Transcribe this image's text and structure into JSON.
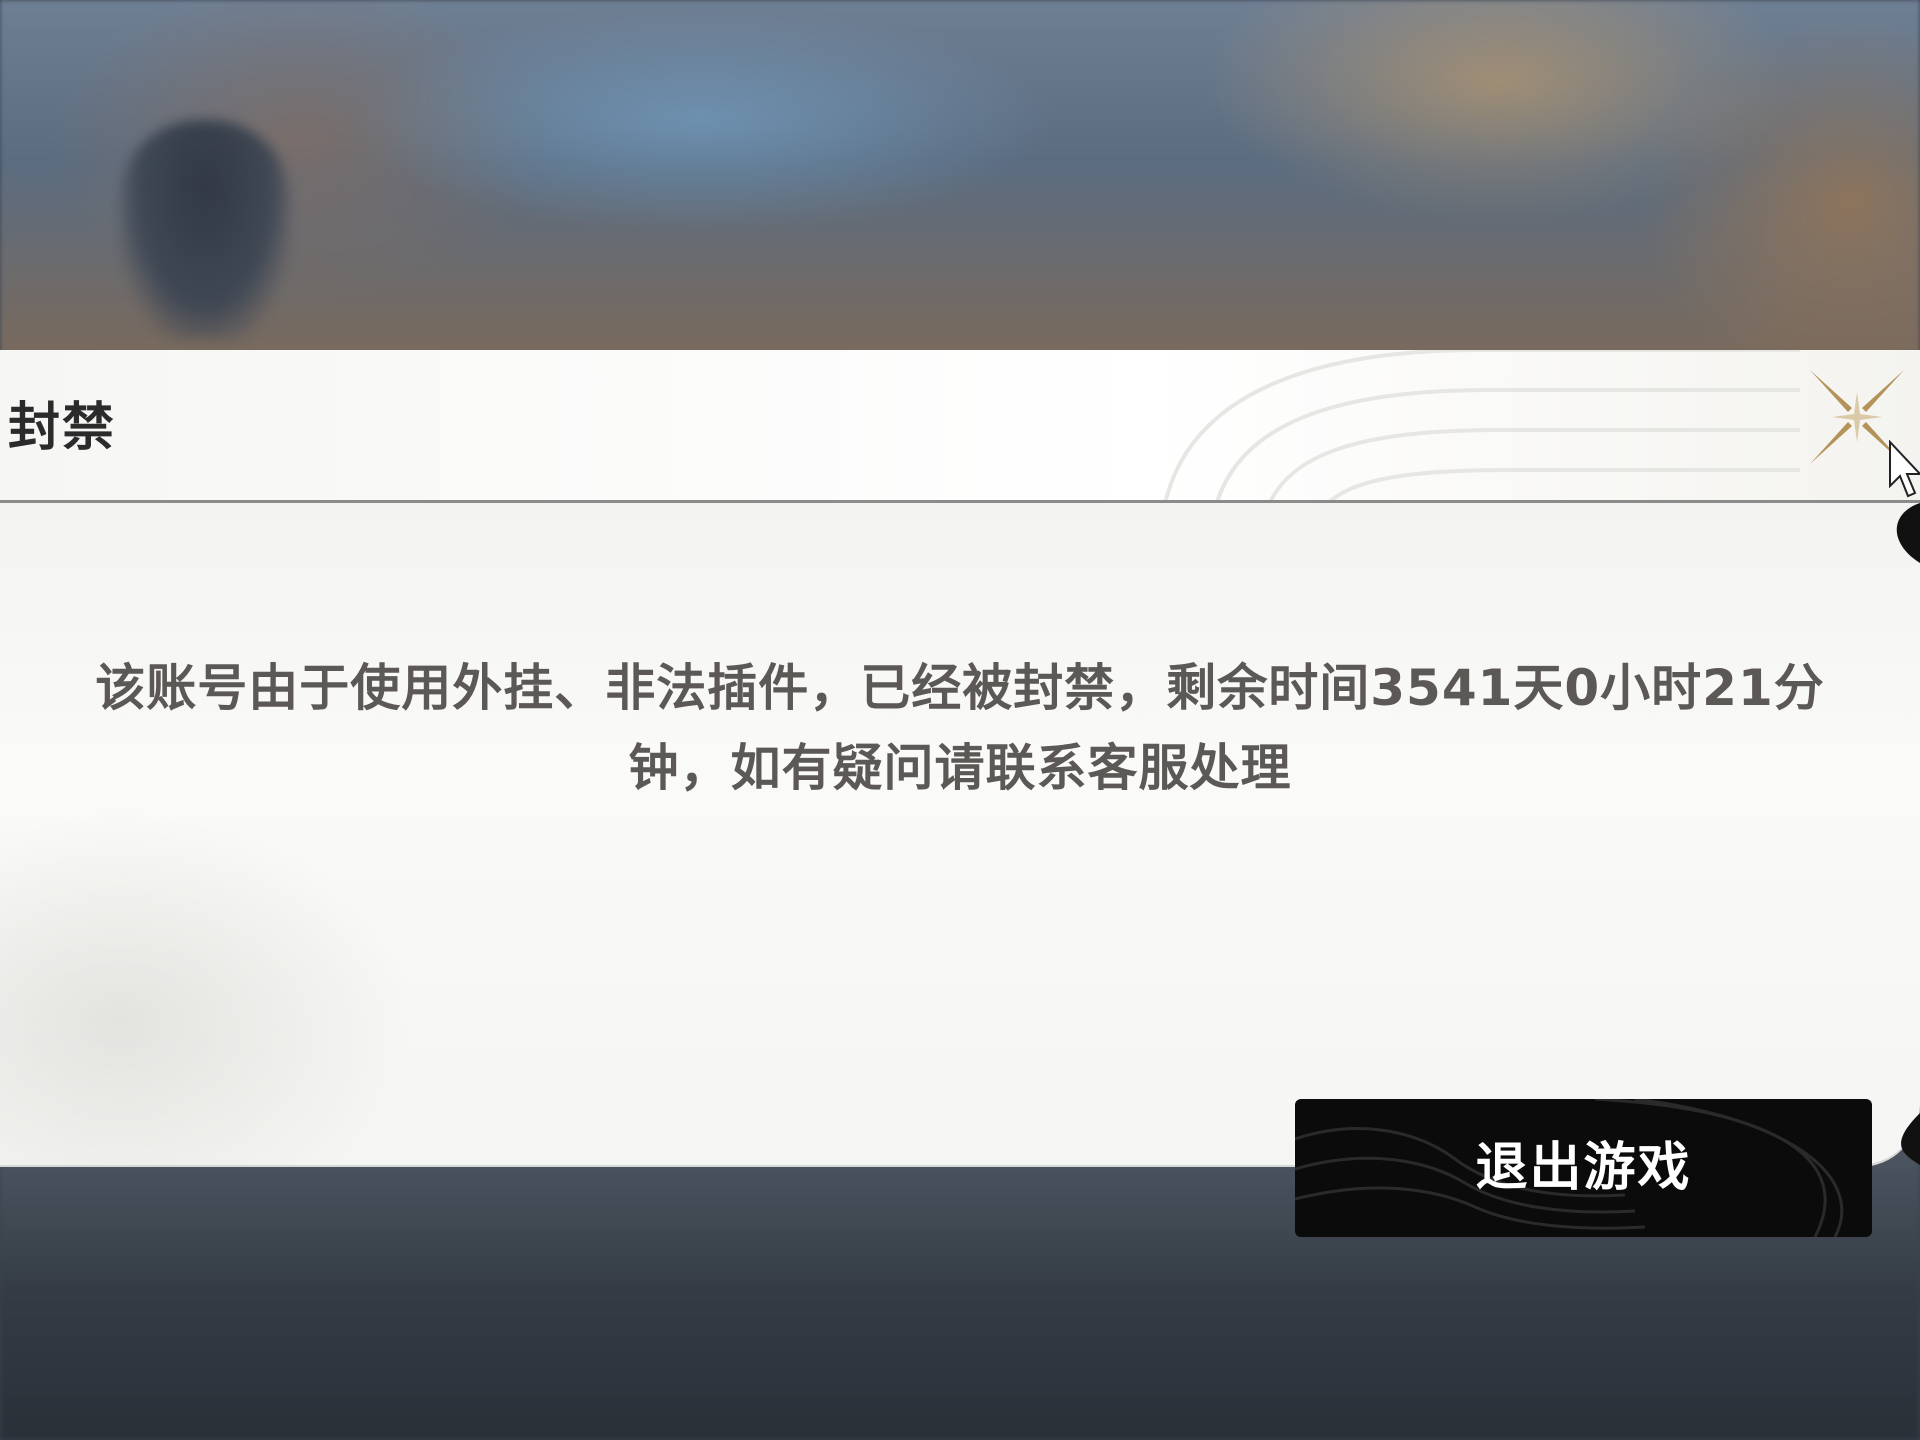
{
  "dialog": {
    "title": "封禁",
    "message_line1": "该账号由于使用外挂、非法插件，已经被封禁，剩余时间3541天0小时21分",
    "message_line2": "钟，如有疑问请联系客服处理",
    "close_icon": "close-icon",
    "exit_button_label": "退出游戏"
  },
  "colors": {
    "accent_gold": "#b3935a",
    "button_bg": "#0b0b0b",
    "text": "#5c5855"
  }
}
